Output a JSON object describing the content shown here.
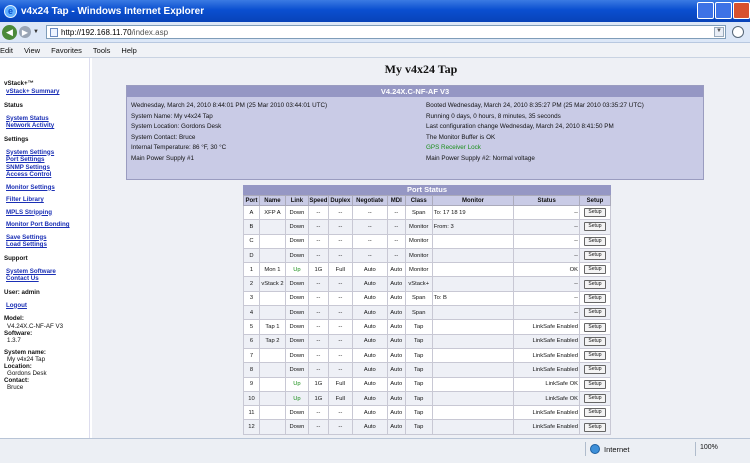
{
  "window": {
    "title": "v4x24 Tap - Windows Internet Explorer"
  },
  "address": {
    "url_host": "http://192.168.11.70",
    "url_path": "/index.asp"
  },
  "menu": [
    "Edit",
    "View",
    "Favorites",
    "Tools",
    "Help"
  ],
  "sidebar": {
    "brand": "vStack+™",
    "summary_link": "vStack+ Summary",
    "status_head": "Status",
    "status_links": [
      "System Status",
      "Network Activity"
    ],
    "settings_head": "Settings",
    "settings_links": [
      "System Settings",
      "Port Settings",
      "SNMP Settings",
      "Access Control"
    ],
    "monitor_settings": "Monitor Settings",
    "filter_library": "Filter Library",
    "mpls": "MPLS Stripping",
    "bonding": "Monitor Port Bonding",
    "save_load": [
      "Save Settings",
      "Load Settings"
    ],
    "support_head": "Support",
    "support_links": [
      "System Software",
      "Contact Us"
    ],
    "user_label": "User: admin",
    "logout": "Logout",
    "model_label": "Model:",
    "model_value": "V4.24X.C-NF-AF V3",
    "software_label": "Software:",
    "software_value": "1.3.7",
    "sysname_label": "System name:",
    "sysname_value": "My v4x24 Tap",
    "location_label": "Location:",
    "location_value": "Gordons Desk",
    "contact_label": "Contact:",
    "contact_value": "Bruce"
  },
  "main": {
    "title": "My v4x24 Tap",
    "info": {
      "header": "V4.24X.C-NF-AF V3",
      "left": [
        "Wednesday, March 24, 2010 8:44:01 PM (25 Mar 2010 03:44:01 UTC)",
        "System Name: My v4x24 Tap",
        "System Location: Gordons Desk",
        "System Contact: Bruce",
        "Internal Temperature: 86 °F, 30 °C",
        "Main Power Supply #1"
      ],
      "right": [
        "Booted Wednesday, March 24, 2010 8:35:27 PM (25 Mar 2010 03:35:27 UTC)",
        "Running 0 days, 0 hours, 8 minutes, 35 seconds",
        "Last configuration change Wednesday, March 24, 2010 8:41:50 PM",
        "The Monitor Buffer is OK",
        "GPS Receiver Lock",
        "Main Power Supply #2: Normal voltage"
      ]
    },
    "ports": {
      "title": "Port Status",
      "headers": [
        "Port",
        "Name",
        "Link",
        "Speed",
        "Duplex",
        "Negotiate",
        "MDI",
        "Class",
        "Monitor",
        "Status",
        "Setup"
      ],
      "setup_label": "Setup",
      "rows": [
        [
          "A",
          "XFP A",
          "Down",
          "--",
          "--",
          "--",
          "--",
          "Span",
          "To:      17 18 19",
          "--"
        ],
        [
          "B",
          "",
          "Down",
          "--",
          "--",
          "--",
          "--",
          "Monitor",
          "From:    3",
          "--"
        ],
        [
          "C",
          "",
          "Down",
          "--",
          "--",
          "--",
          "--",
          "Monitor",
          "",
          "--"
        ],
        [
          "D",
          "",
          "Down",
          "--",
          "--",
          "--",
          "--",
          "Monitor",
          "",
          "--"
        ],
        [
          "1",
          "Mon 1",
          "Up",
          "1G",
          "Full",
          "Auto",
          "Auto",
          "Monitor",
          "",
          "OK"
        ],
        [
          "2",
          "vStack 2",
          "Down",
          "--",
          "--",
          "Auto",
          "Auto",
          "vStack+",
          "",
          "--"
        ],
        [
          "3",
          "",
          "Down",
          "--",
          "--",
          "Auto",
          "Auto",
          "Span",
          "To:   B",
          "--"
        ],
        [
          "4",
          "",
          "Down",
          "--",
          "--",
          "Auto",
          "Auto",
          "Span",
          "",
          "--"
        ],
        [
          "5",
          "Tap 1",
          "Down",
          "--",
          "--",
          "Auto",
          "Auto",
          "Tap",
          "",
          "LinkSafe Enabled"
        ],
        [
          "6",
          "Tap 2",
          "Down",
          "--",
          "--",
          "Auto",
          "Auto",
          "Tap",
          "",
          "LinkSafe Enabled"
        ],
        [
          "7",
          "",
          "Down",
          "--",
          "--",
          "Auto",
          "Auto",
          "Tap",
          "",
          "LinkSafe Enabled"
        ],
        [
          "8",
          "",
          "Down",
          "--",
          "--",
          "Auto",
          "Auto",
          "Tap",
          "",
          "LinkSafe Enabled"
        ],
        [
          "9",
          "",
          "Up",
          "1G",
          "Full",
          "Auto",
          "Auto",
          "Tap",
          "",
          "LinkSafe OK"
        ],
        [
          "10",
          "",
          "Up",
          "1G",
          "Full",
          "Auto",
          "Auto",
          "Tap",
          "",
          "LinkSafe OK"
        ],
        [
          "11",
          "",
          "Down",
          "--",
          "--",
          "Auto",
          "Auto",
          "Tap",
          "",
          "LinkSafe Enabled"
        ],
        [
          "12",
          "",
          "Down",
          "--",
          "--",
          "Auto",
          "Auto",
          "Tap",
          "",
          "LinkSafe Enabled"
        ]
      ]
    }
  },
  "status": {
    "zone": "Internet",
    "zoom": "100%"
  }
}
